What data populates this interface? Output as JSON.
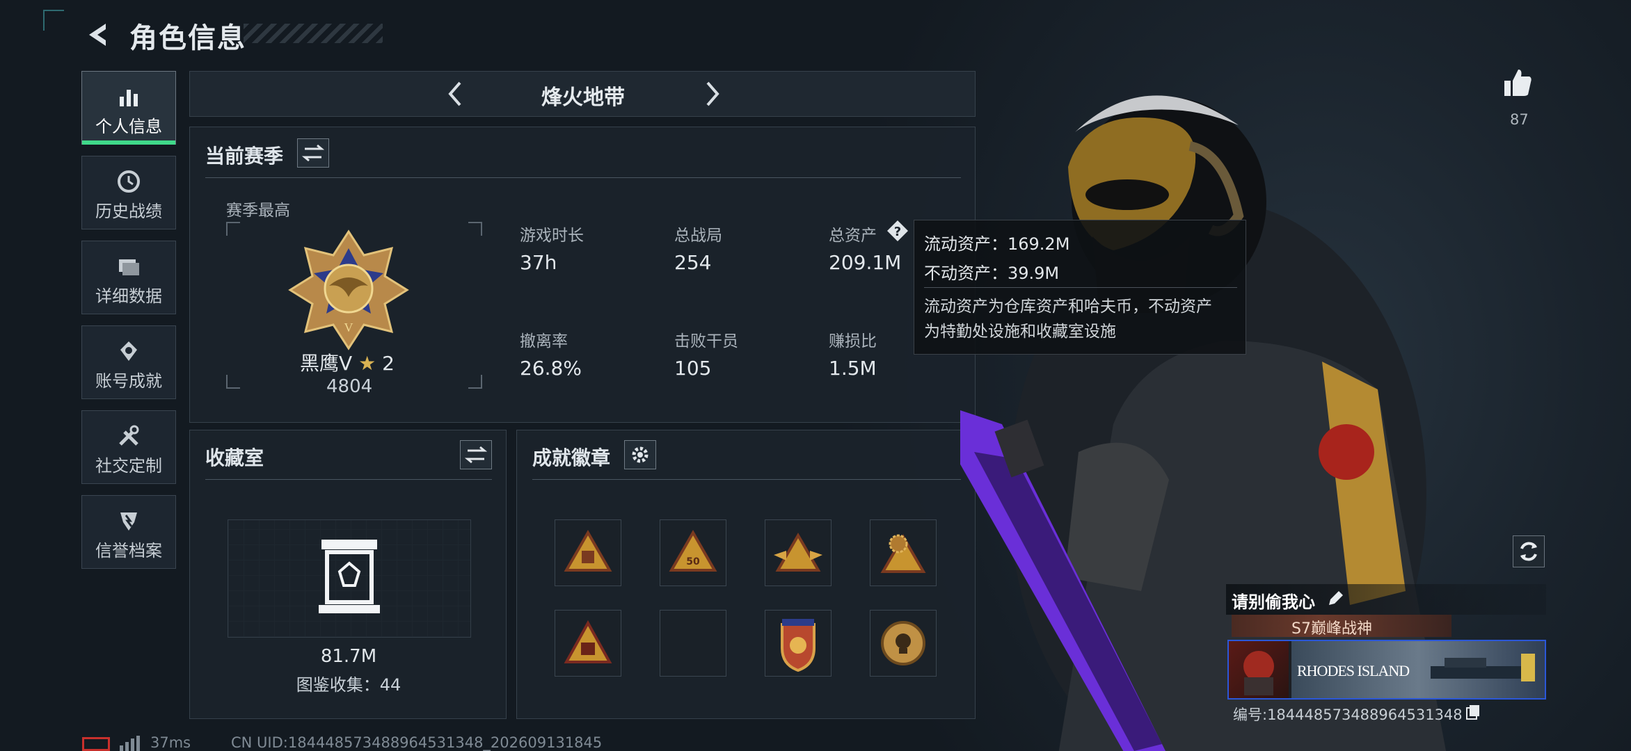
{
  "header": {
    "title": "角色信息"
  },
  "sidebar": {
    "items": [
      {
        "label": "个人信息",
        "active": true,
        "icon": "bar-chart-icon"
      },
      {
        "label": "历史战绩",
        "icon": "clock-icon"
      },
      {
        "label": "详细数据",
        "icon": "folder-icon"
      },
      {
        "label": "账号成就",
        "icon": "achievement-icon"
      },
      {
        "label": "社交定制",
        "icon": "tools-icon"
      },
      {
        "label": "信誉档案",
        "icon": "shield-icon"
      }
    ]
  },
  "mode": {
    "title": "烽火地带"
  },
  "season": {
    "title": "当前赛季",
    "best_label": "赛季最高",
    "rank_name": "黑鹰V",
    "rank_stars": "2",
    "rank_score": "4804",
    "stats": [
      {
        "label": "游戏时长",
        "value": "37h"
      },
      {
        "label": "总战局",
        "value": "254"
      },
      {
        "label": "总资产",
        "value": "209.1M"
      },
      {
        "label": "撤离率",
        "value": "26.8%"
      },
      {
        "label": "击败干员",
        "value": "105"
      },
      {
        "label": "赚损比",
        "value": "1.5M"
      }
    ]
  },
  "tooltip": {
    "liquid": "流动资产：169.2M",
    "fixed": "不动资产：39.9M",
    "desc1": "流动资产为仓库资产和哈夫币，不动资产",
    "desc2": "为特勤处设施和收藏室设施"
  },
  "collection": {
    "title": "收藏室",
    "value": "81.7M",
    "codex": "图鉴收集：44"
  },
  "badges": {
    "title": "成就徽章",
    "count": 8
  },
  "profile": {
    "likes": "87",
    "name": "请别偷我心",
    "banner_title": "S7巅峰战神",
    "card_text": "RHODES ISLAND",
    "id_line": "编号:18444857348896453134​8"
  },
  "footer": {
    "ping": "37ms",
    "uid": "CN UID:18444857348896453134​8_202609131845"
  },
  "colors": {
    "accent_green": "#40d98a",
    "gold": "#c9a052",
    "card_blue": "#2b57d8"
  }
}
